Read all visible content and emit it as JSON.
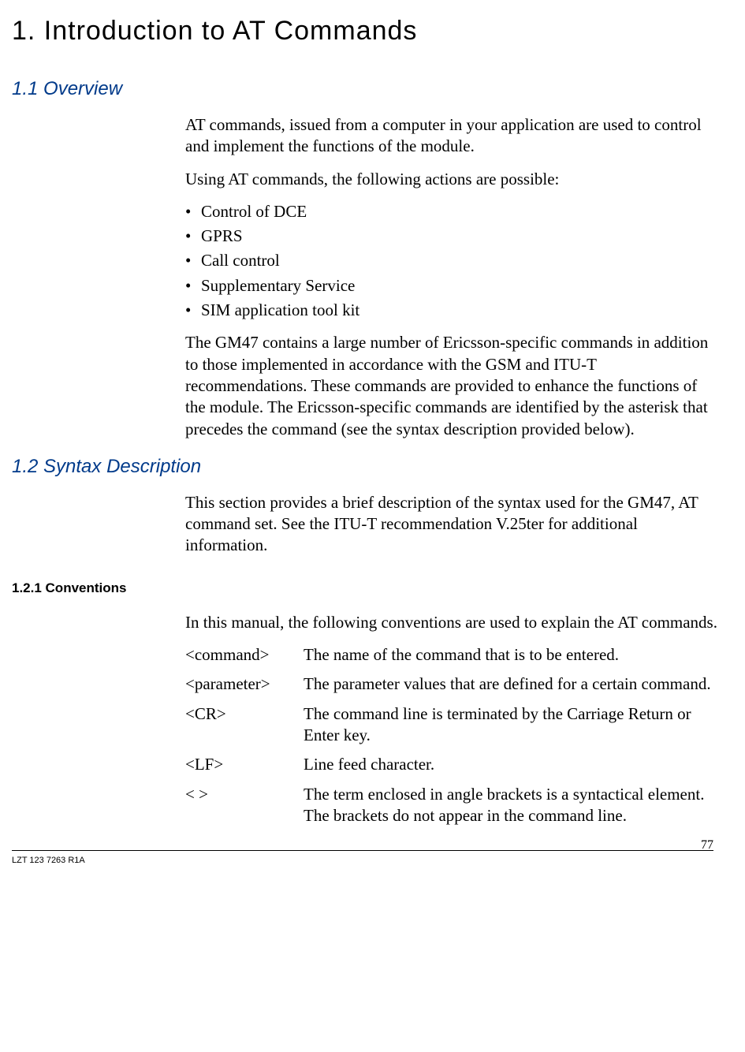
{
  "chapter_title": "1. Introduction to AT Commands",
  "section_1_1": {
    "heading": "1.1 Overview",
    "p1": "AT commands, issued from a computer in your application are used to control and implement the functions of the module.",
    "p2": "Using AT commands, the following actions are possible:",
    "bullets": [
      "Control of DCE",
      "GPRS",
      "Call control",
      "Supplementary Service",
      "SIM application tool kit"
    ],
    "p3": "The GM47 contains a large number of Ericsson-specific commands in addition to those implemented in accordance with the GSM and ITU-T recommendations. These commands are provided to enhance the functions of the module. The Ericsson-specific commands are identified by the asterisk that precedes the command (see the syntax description provided below)."
  },
  "section_1_2": {
    "heading": "1.2 Syntax Description",
    "p1": "This section provides a brief description of the syntax used for the GM47, AT command set. See the ITU-T recommendation V.25ter for additional information."
  },
  "section_1_2_1": {
    "heading": "1.2.1 Conventions",
    "p1": "In this manual, the following conventions are used to explain the AT commands.",
    "definitions": [
      {
        "term": "<command>",
        "desc": "The name of the command that is to be entered."
      },
      {
        "term": "<parameter>",
        "desc": "The parameter values that are defined for a certain command."
      },
      {
        "term": "<CR>",
        "desc": "The command line is terminated by the Carriage Return or Enter key."
      },
      {
        "term": "<LF>",
        "desc": "Line feed character."
      },
      {
        "term": "< >",
        "desc": "The term enclosed in angle brackets is a syntactical element. The brackets do not appear in the command line."
      }
    ]
  },
  "footer": {
    "doc_id": "LZT 123 7263 R1A",
    "page_number": "77"
  }
}
